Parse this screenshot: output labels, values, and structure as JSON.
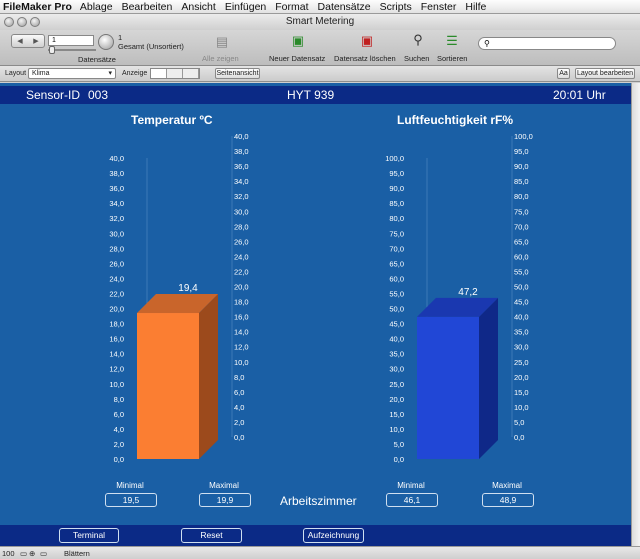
{
  "menubar": {
    "app": "FileMaker Pro",
    "items": [
      "Ablage",
      "Bearbeiten",
      "Ansicht",
      "Einfügen",
      "Format",
      "Datensätze",
      "Scripts",
      "Fenster",
      "Hilfe"
    ]
  },
  "window": {
    "title": "Smart Metering"
  },
  "toolbar": {
    "record_number": "1",
    "total": "1",
    "total_label": "Gesamt (Unsortiert)",
    "records_label": "Datensätze",
    "show_all": "Alle zeigen",
    "new_record": "Neuer Datensatz",
    "delete_record": "Datensatz löschen",
    "find": "Suchen",
    "sort": "Sortieren",
    "search_placeholder": ""
  },
  "layoutbar": {
    "layout_label": "Layout",
    "layout_value": "Klima",
    "view_label": "Anzeige",
    "preview": "Seitenansicht",
    "aa": "Aa",
    "edit_layout": "Layout bearbeiten"
  },
  "sensor": {
    "id_label": "Sensor-ID",
    "id": "003",
    "model": "HYT 939",
    "time": "20:01 Uhr"
  },
  "chart_data": [
    {
      "type": "bar",
      "title": "Temperatur ºC",
      "value": 19.4,
      "value_label": "19,4",
      "ylim": [
        0,
        40
      ],
      "ticks": [
        "0,0",
        "2,0",
        "4,0",
        "6,0",
        "8,0",
        "10,0",
        "12,0",
        "14,0",
        "16,0",
        "18,0",
        "20,0",
        "22,0",
        "24,0",
        "26,0",
        "28,0",
        "30,0",
        "32,0",
        "34,0",
        "36,0",
        "38,0",
        "40,0"
      ],
      "color": "#fb7e32",
      "side_color": "#9c4a1c",
      "top_color": "#c9652b"
    },
    {
      "type": "bar",
      "title": "Luftfeuchtigkeit rF%",
      "value": 47.2,
      "value_label": "47,2",
      "ylim": [
        0,
        100
      ],
      "ticks": [
        "0,0",
        "5,0",
        "10,0",
        "15,0",
        "20,0",
        "25,0",
        "30,0",
        "35,0",
        "40,0",
        "45,0",
        "50,0",
        "55,0",
        "60,0",
        "65,0",
        "70,0",
        "75,0",
        "80,0",
        "85,0",
        "90,0",
        "95,0",
        "100,0"
      ],
      "color": "#2147d6",
      "side_color": "#0f2888",
      "top_color": "#1a38b0"
    }
  ],
  "stats": {
    "temp": {
      "min_label": "Minimal",
      "min": "19,5",
      "max_label": "Maximal",
      "max": "19,9"
    },
    "hum": {
      "min_label": "Minimal",
      "min": "46,1",
      "max_label": "Maximal",
      "max": "48,9"
    }
  },
  "room": "Arbeitszimmer",
  "buttons": {
    "terminal": "Terminal",
    "reset": "Reset",
    "record": "Aufzeichnung"
  },
  "status": {
    "zoom": "100",
    "mode": "Blättern"
  }
}
